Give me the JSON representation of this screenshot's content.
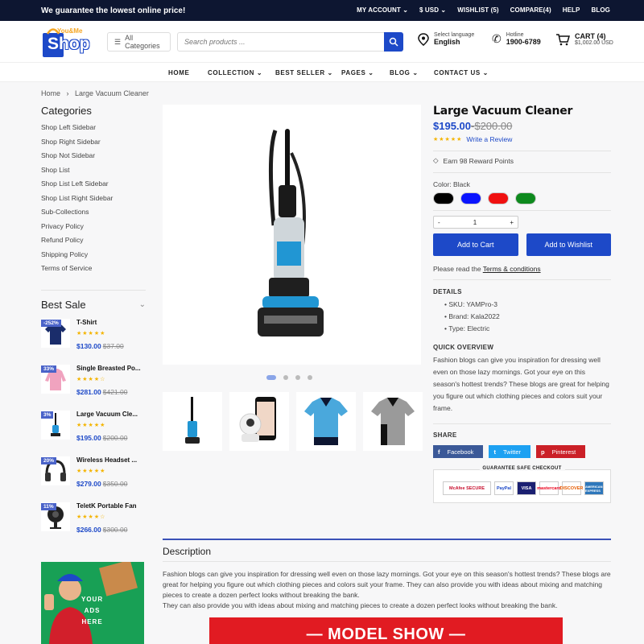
{
  "topbar": {
    "promo": "We guarantee the lowest online price!",
    "links": [
      "MY ACCOUNT ⌄",
      "$ USD ⌄",
      "WISHLIST (5)",
      "COMPARE(4)",
      "HELP",
      "BLOG"
    ]
  },
  "header": {
    "logo_top": "You&Me",
    "logo_main": "Shop",
    "all_categories": "All Categories",
    "search_placeholder": "Search products ...",
    "language_label": "Select language",
    "language_value": "English",
    "hotline_label": "Hotline",
    "hotline_value": "1900-6789",
    "cart_label": "CART (4)",
    "cart_total": "$1,002.00 USD"
  },
  "nav": [
    "HOME",
    "COLLECTION",
    "BEST SELLER",
    "PAGES",
    "BLOG",
    "CONTACT US"
  ],
  "breadcrumb": {
    "home": "Home",
    "current": "Large Vacuum Cleaner"
  },
  "sidebar": {
    "categories_title": "Categories",
    "categories": [
      "Shop Left Sidebar",
      "Shop Right Sidebar",
      "Shop Not Sidebar",
      "Shop List",
      "Shop List Left Sidebar",
      "Shop List Right Sidebar",
      "Sub-Collections",
      "Privacy Policy",
      "Refund Policy",
      "Shipping Policy",
      "Terms of Service"
    ],
    "best_sale_title": "Best Sale",
    "best_sale": [
      {
        "badge": "-252%",
        "name": "T-Shirt",
        "price": "$130.00",
        "old": "$37.00",
        "stars": "★★★★★"
      },
      {
        "badge": "33%",
        "name": "Single Breasted Po...",
        "price": "$281.00",
        "old": "$421.00",
        "stars": "★★★★☆"
      },
      {
        "badge": "3%",
        "name": "Large Vacuum Cle...",
        "price": "$195.00",
        "old": "$200.00",
        "stars": "★★★★★"
      },
      {
        "badge": "20%",
        "name": "Wireless Headset ...",
        "price": "$279.00",
        "old": "$350.00",
        "stars": "★★★★★"
      },
      {
        "badge": "11%",
        "name": "TeletK Portable Fan",
        "price": "$266.00",
        "old": "$300.00",
        "stars": "★★★★☆"
      }
    ],
    "ad_text": [
      "YOUR",
      "ADS",
      "HERE"
    ]
  },
  "product": {
    "title": "Large Vacuum Cleaner",
    "price": "$195.00",
    "old_price": "$200.00",
    "stars": "★★★★★",
    "write_review": "Write a Review",
    "reward": "Earn 98 Reward Points",
    "color_label": "Color: Black",
    "swatches": [
      "#000000",
      "#0a14ff",
      "#f01010",
      "#0e8a1e"
    ],
    "qty_minus": "-",
    "qty_value": "1",
    "qty_plus": "+",
    "add_to_cart": "Add to Cart",
    "add_to_wishlist": "Add to Wishlist",
    "terms_prefix": "Please read the",
    "terms_link": "Terms & conditions",
    "details_heading": "DETAILS",
    "details": [
      "SKU: YAMPro-3",
      "Brand: Kala2022",
      "Type: Electric"
    ],
    "overview_heading": "QUICK OVERVIEW",
    "overview": "Fashion blogs can give you inspiration for dressing well even on those lazy mornings. Got your eye on this season's hottest trends? These blogs are great for helping you figure out which clothing pieces and colors suit your frame.",
    "share_heading": "SHARE",
    "share": [
      "Facebook",
      "Twitter",
      "Pinterest"
    ],
    "checkout_label": "GUARANTEE SAFE CHECKOUT",
    "payments": [
      "McAfee SECURE",
      "PayPal",
      "VISA",
      "mastercard",
      "DISCOVER",
      "AMERICAN EXPRESS"
    ]
  },
  "description": {
    "heading": "Description",
    "text1": "Fashion blogs can give you inspiration for dressing well even on those lazy mornings. Got your eye on this season's hottest trends? These blogs are great for helping you figure out which clothing pieces and colors suit your frame. They can also provide you with ideas about mixing and matching pieces to create a dozen perfect looks without breaking the bank.",
    "text2": "They can also provide you with ideas about mixing and matching pieces to create a dozen perfect looks without breaking the bank.",
    "model_show": "— MODEL SHOW —"
  }
}
